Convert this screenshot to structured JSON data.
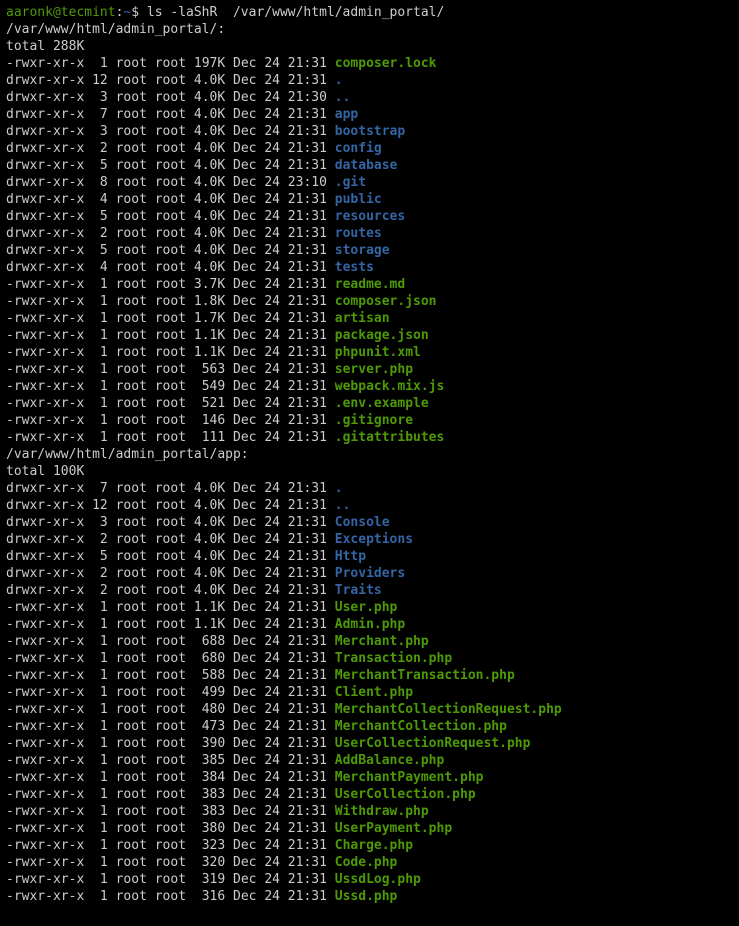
{
  "prompt": {
    "user": "aaronk",
    "host": "tecmint",
    "cwd": "~",
    "command": "ls -laShR  /var/www/html/admin_portal/"
  },
  "sections": [
    {
      "header": "/var/www/html/admin_portal/:",
      "total": "total 288K",
      "rows": [
        {
          "perm": "-rwxr-xr-x",
          "links": " 1",
          "owner": "root",
          "group": "root",
          "size": "197K",
          "date": "Dec 24 21:31",
          "name": "composer.lock",
          "type": "exe"
        },
        {
          "perm": "drwxr-xr-x",
          "links": "12",
          "owner": "root",
          "group": "root",
          "size": "4.0K",
          "date": "Dec 24 21:31",
          "name": ".",
          "type": "dir"
        },
        {
          "perm": "drwxr-xr-x",
          "links": " 3",
          "owner": "root",
          "group": "root",
          "size": "4.0K",
          "date": "Dec 24 21:30",
          "name": "..",
          "type": "dir"
        },
        {
          "perm": "drwxr-xr-x",
          "links": " 7",
          "owner": "root",
          "group": "root",
          "size": "4.0K",
          "date": "Dec 24 21:31",
          "name": "app",
          "type": "dir"
        },
        {
          "perm": "drwxr-xr-x",
          "links": " 3",
          "owner": "root",
          "group": "root",
          "size": "4.0K",
          "date": "Dec 24 21:31",
          "name": "bootstrap",
          "type": "dir"
        },
        {
          "perm": "drwxr-xr-x",
          "links": " 2",
          "owner": "root",
          "group": "root",
          "size": "4.0K",
          "date": "Dec 24 21:31",
          "name": "config",
          "type": "dir"
        },
        {
          "perm": "drwxr-xr-x",
          "links": " 5",
          "owner": "root",
          "group": "root",
          "size": "4.0K",
          "date": "Dec 24 21:31",
          "name": "database",
          "type": "dir"
        },
        {
          "perm": "drwxr-xr-x",
          "links": " 8",
          "owner": "root",
          "group": "root",
          "size": "4.0K",
          "date": "Dec 24 23:10",
          "name": ".git",
          "type": "dir"
        },
        {
          "perm": "drwxr-xr-x",
          "links": " 4",
          "owner": "root",
          "group": "root",
          "size": "4.0K",
          "date": "Dec 24 21:31",
          "name": "public",
          "type": "dir"
        },
        {
          "perm": "drwxr-xr-x",
          "links": " 5",
          "owner": "root",
          "group": "root",
          "size": "4.0K",
          "date": "Dec 24 21:31",
          "name": "resources",
          "type": "dir"
        },
        {
          "perm": "drwxr-xr-x",
          "links": " 2",
          "owner": "root",
          "group": "root",
          "size": "4.0K",
          "date": "Dec 24 21:31",
          "name": "routes",
          "type": "dir"
        },
        {
          "perm": "drwxr-xr-x",
          "links": " 5",
          "owner": "root",
          "group": "root",
          "size": "4.0K",
          "date": "Dec 24 21:31",
          "name": "storage",
          "type": "dir"
        },
        {
          "perm": "drwxr-xr-x",
          "links": " 4",
          "owner": "root",
          "group": "root",
          "size": "4.0K",
          "date": "Dec 24 21:31",
          "name": "tests",
          "type": "dir"
        },
        {
          "perm": "-rwxr-xr-x",
          "links": " 1",
          "owner": "root",
          "group": "root",
          "size": "3.7K",
          "date": "Dec 24 21:31",
          "name": "readme.md",
          "type": "exe"
        },
        {
          "perm": "-rwxr-xr-x",
          "links": " 1",
          "owner": "root",
          "group": "root",
          "size": "1.8K",
          "date": "Dec 24 21:31",
          "name": "composer.json",
          "type": "exe"
        },
        {
          "perm": "-rwxr-xr-x",
          "links": " 1",
          "owner": "root",
          "group": "root",
          "size": "1.7K",
          "date": "Dec 24 21:31",
          "name": "artisan",
          "type": "exe"
        },
        {
          "perm": "-rwxr-xr-x",
          "links": " 1",
          "owner": "root",
          "group": "root",
          "size": "1.1K",
          "date": "Dec 24 21:31",
          "name": "package.json",
          "type": "exe"
        },
        {
          "perm": "-rwxr-xr-x",
          "links": " 1",
          "owner": "root",
          "group": "root",
          "size": "1.1K",
          "date": "Dec 24 21:31",
          "name": "phpunit.xml",
          "type": "exe"
        },
        {
          "perm": "-rwxr-xr-x",
          "links": " 1",
          "owner": "root",
          "group": "root",
          "size": " 563",
          "date": "Dec 24 21:31",
          "name": "server.php",
          "type": "exe"
        },
        {
          "perm": "-rwxr-xr-x",
          "links": " 1",
          "owner": "root",
          "group": "root",
          "size": " 549",
          "date": "Dec 24 21:31",
          "name": "webpack.mix.js",
          "type": "exe"
        },
        {
          "perm": "-rwxr-xr-x",
          "links": " 1",
          "owner": "root",
          "group": "root",
          "size": " 521",
          "date": "Dec 24 21:31",
          "name": ".env.example",
          "type": "exe"
        },
        {
          "perm": "-rwxr-xr-x",
          "links": " 1",
          "owner": "root",
          "group": "root",
          "size": " 146",
          "date": "Dec 24 21:31",
          "name": ".gitignore",
          "type": "exe"
        },
        {
          "perm": "-rwxr-xr-x",
          "links": " 1",
          "owner": "root",
          "group": "root",
          "size": " 111",
          "date": "Dec 24 21:31",
          "name": ".gitattributes",
          "type": "exe"
        }
      ]
    },
    {
      "header": "/var/www/html/admin_portal/app:",
      "total": "total 100K",
      "rows": [
        {
          "perm": "drwxr-xr-x",
          "links": " 7",
          "owner": "root",
          "group": "root",
          "size": "4.0K",
          "date": "Dec 24 21:31",
          "name": ".",
          "type": "dir"
        },
        {
          "perm": "drwxr-xr-x",
          "links": "12",
          "owner": "root",
          "group": "root",
          "size": "4.0K",
          "date": "Dec 24 21:31",
          "name": "..",
          "type": "dir"
        },
        {
          "perm": "drwxr-xr-x",
          "links": " 3",
          "owner": "root",
          "group": "root",
          "size": "4.0K",
          "date": "Dec 24 21:31",
          "name": "Console",
          "type": "dir"
        },
        {
          "perm": "drwxr-xr-x",
          "links": " 2",
          "owner": "root",
          "group": "root",
          "size": "4.0K",
          "date": "Dec 24 21:31",
          "name": "Exceptions",
          "type": "dir"
        },
        {
          "perm": "drwxr-xr-x",
          "links": " 5",
          "owner": "root",
          "group": "root",
          "size": "4.0K",
          "date": "Dec 24 21:31",
          "name": "Http",
          "type": "dir"
        },
        {
          "perm": "drwxr-xr-x",
          "links": " 2",
          "owner": "root",
          "group": "root",
          "size": "4.0K",
          "date": "Dec 24 21:31",
          "name": "Providers",
          "type": "dir"
        },
        {
          "perm": "drwxr-xr-x",
          "links": " 2",
          "owner": "root",
          "group": "root",
          "size": "4.0K",
          "date": "Dec 24 21:31",
          "name": "Traits",
          "type": "dir"
        },
        {
          "perm": "-rwxr-xr-x",
          "links": " 1",
          "owner": "root",
          "group": "root",
          "size": "1.1K",
          "date": "Dec 24 21:31",
          "name": "User.php",
          "type": "exe"
        },
        {
          "perm": "-rwxr-xr-x",
          "links": " 1",
          "owner": "root",
          "group": "root",
          "size": "1.1K",
          "date": "Dec 24 21:31",
          "name": "Admin.php",
          "type": "exe"
        },
        {
          "perm": "-rwxr-xr-x",
          "links": " 1",
          "owner": "root",
          "group": "root",
          "size": " 688",
          "date": "Dec 24 21:31",
          "name": "Merchant.php",
          "type": "exe"
        },
        {
          "perm": "-rwxr-xr-x",
          "links": " 1",
          "owner": "root",
          "group": "root",
          "size": " 680",
          "date": "Dec 24 21:31",
          "name": "Transaction.php",
          "type": "exe"
        },
        {
          "perm": "-rwxr-xr-x",
          "links": " 1",
          "owner": "root",
          "group": "root",
          "size": " 588",
          "date": "Dec 24 21:31",
          "name": "MerchantTransaction.php",
          "type": "exe"
        },
        {
          "perm": "-rwxr-xr-x",
          "links": " 1",
          "owner": "root",
          "group": "root",
          "size": " 499",
          "date": "Dec 24 21:31",
          "name": "Client.php",
          "type": "exe"
        },
        {
          "perm": "-rwxr-xr-x",
          "links": " 1",
          "owner": "root",
          "group": "root",
          "size": " 480",
          "date": "Dec 24 21:31",
          "name": "MerchantCollectionRequest.php",
          "type": "exe"
        },
        {
          "perm": "-rwxr-xr-x",
          "links": " 1",
          "owner": "root",
          "group": "root",
          "size": " 473",
          "date": "Dec 24 21:31",
          "name": "MerchantCollection.php",
          "type": "exe"
        },
        {
          "perm": "-rwxr-xr-x",
          "links": " 1",
          "owner": "root",
          "group": "root",
          "size": " 390",
          "date": "Dec 24 21:31",
          "name": "UserCollectionRequest.php",
          "type": "exe"
        },
        {
          "perm": "-rwxr-xr-x",
          "links": " 1",
          "owner": "root",
          "group": "root",
          "size": " 385",
          "date": "Dec 24 21:31",
          "name": "AddBalance.php",
          "type": "exe"
        },
        {
          "perm": "-rwxr-xr-x",
          "links": " 1",
          "owner": "root",
          "group": "root",
          "size": " 384",
          "date": "Dec 24 21:31",
          "name": "MerchantPayment.php",
          "type": "exe"
        },
        {
          "perm": "-rwxr-xr-x",
          "links": " 1",
          "owner": "root",
          "group": "root",
          "size": " 383",
          "date": "Dec 24 21:31",
          "name": "UserCollection.php",
          "type": "exe"
        },
        {
          "perm": "-rwxr-xr-x",
          "links": " 1",
          "owner": "root",
          "group": "root",
          "size": " 383",
          "date": "Dec 24 21:31",
          "name": "Withdraw.php",
          "type": "exe"
        },
        {
          "perm": "-rwxr-xr-x",
          "links": " 1",
          "owner": "root",
          "group": "root",
          "size": " 380",
          "date": "Dec 24 21:31",
          "name": "UserPayment.php",
          "type": "exe"
        },
        {
          "perm": "-rwxr-xr-x",
          "links": " 1",
          "owner": "root",
          "group": "root",
          "size": " 323",
          "date": "Dec 24 21:31",
          "name": "Charge.php",
          "type": "exe"
        },
        {
          "perm": "-rwxr-xr-x",
          "links": " 1",
          "owner": "root",
          "group": "root",
          "size": " 320",
          "date": "Dec 24 21:31",
          "name": "Code.php",
          "type": "exe"
        },
        {
          "perm": "-rwxr-xr-x",
          "links": " 1",
          "owner": "root",
          "group": "root",
          "size": " 319",
          "date": "Dec 24 21:31",
          "name": "UssdLog.php",
          "type": "exe"
        },
        {
          "perm": "-rwxr-xr-x",
          "links": " 1",
          "owner": "root",
          "group": "root",
          "size": " 316",
          "date": "Dec 24 21:31",
          "name": "Ussd.php",
          "type": "exe"
        }
      ]
    }
  ]
}
